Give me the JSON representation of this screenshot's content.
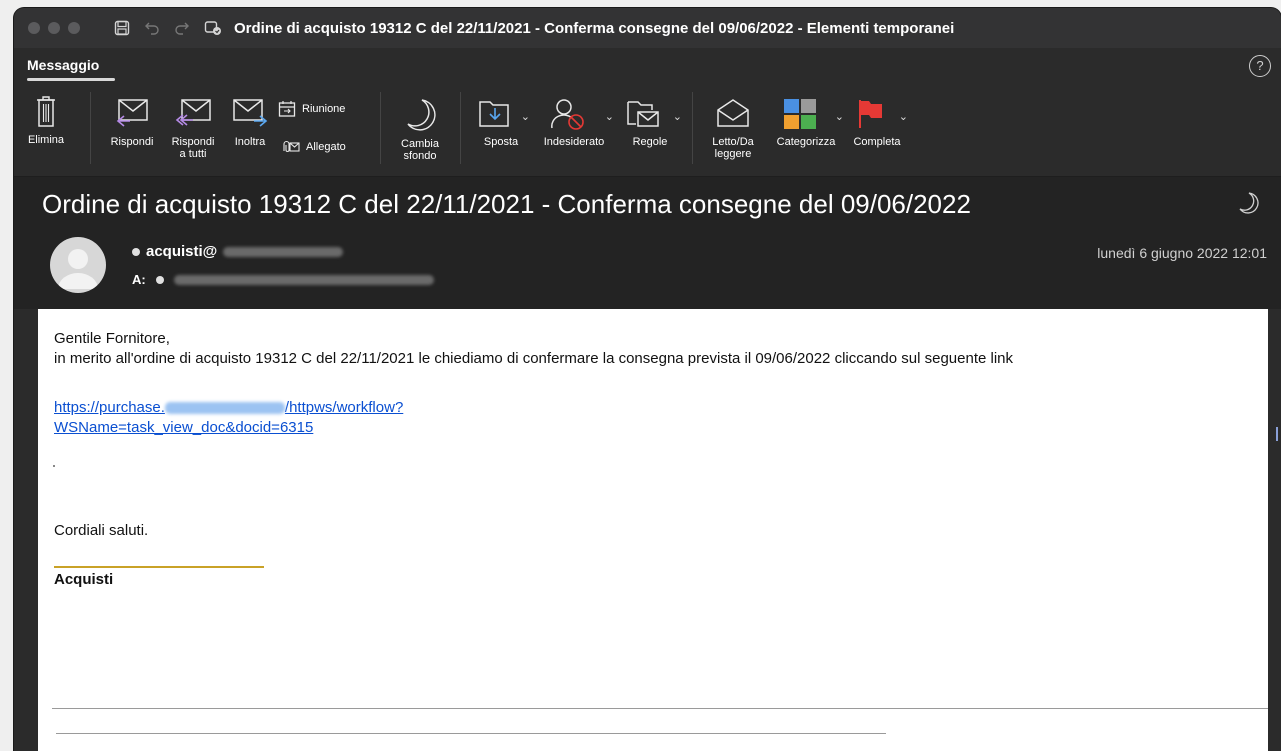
{
  "window": {
    "title": "Ordine di acquisto 19312 C del 22/11/2021 - Conferma consegne del 09/06/2022 - Elementi temporanei"
  },
  "ribbon": {
    "tab_label": "Messaggio",
    "help_label": "?",
    "elimina": "Elimina",
    "rispondi": "Rispondi",
    "rispondi_tutti_1": "Rispondi",
    "rispondi_tutti_2": "a tutti",
    "inoltra": "Inoltra",
    "riunione": "Riunione",
    "allegato": "Allegato",
    "cambia_1": "Cambia",
    "cambia_2": "sfondo",
    "sposta": "Sposta",
    "indesiderato": "Indesiderato",
    "regole": "Regole",
    "letto_1": "Letto/Da",
    "letto_2": "leggere",
    "categorizza": "Categorizza",
    "completa": "Completa"
  },
  "message": {
    "subject": "Ordine di acquisto 19312 C del 22/11/2021 - Conferma consegne del 09/06/2022",
    "sender_prefix": "acquisti@",
    "to_label": "A:",
    "date": "lunedì 6 giugno 2022 12:01",
    "greeting": "Gentile Fornitore,",
    "body_line": "in merito all'ordine di acquisto 19312 C del 22/11/2021 le chiediamo di confermare la consegna prevista il 09/06/2022 cliccando sul seguente link",
    "link_part1": "https://purchase.",
    "link_part2": "/httpws/workflow?",
    "link_part3": "WSName=task_view_doc&docid=6315",
    "closing": "Cordiali saluti.",
    "signature": "Acquisti"
  },
  "colors": {
    "titlebar": "#333334",
    "ribbon": "#2b2b2b",
    "header": "#232323",
    "link": "#0a4fd1",
    "signature_line": "#c9a227",
    "flag": "#e53935"
  }
}
